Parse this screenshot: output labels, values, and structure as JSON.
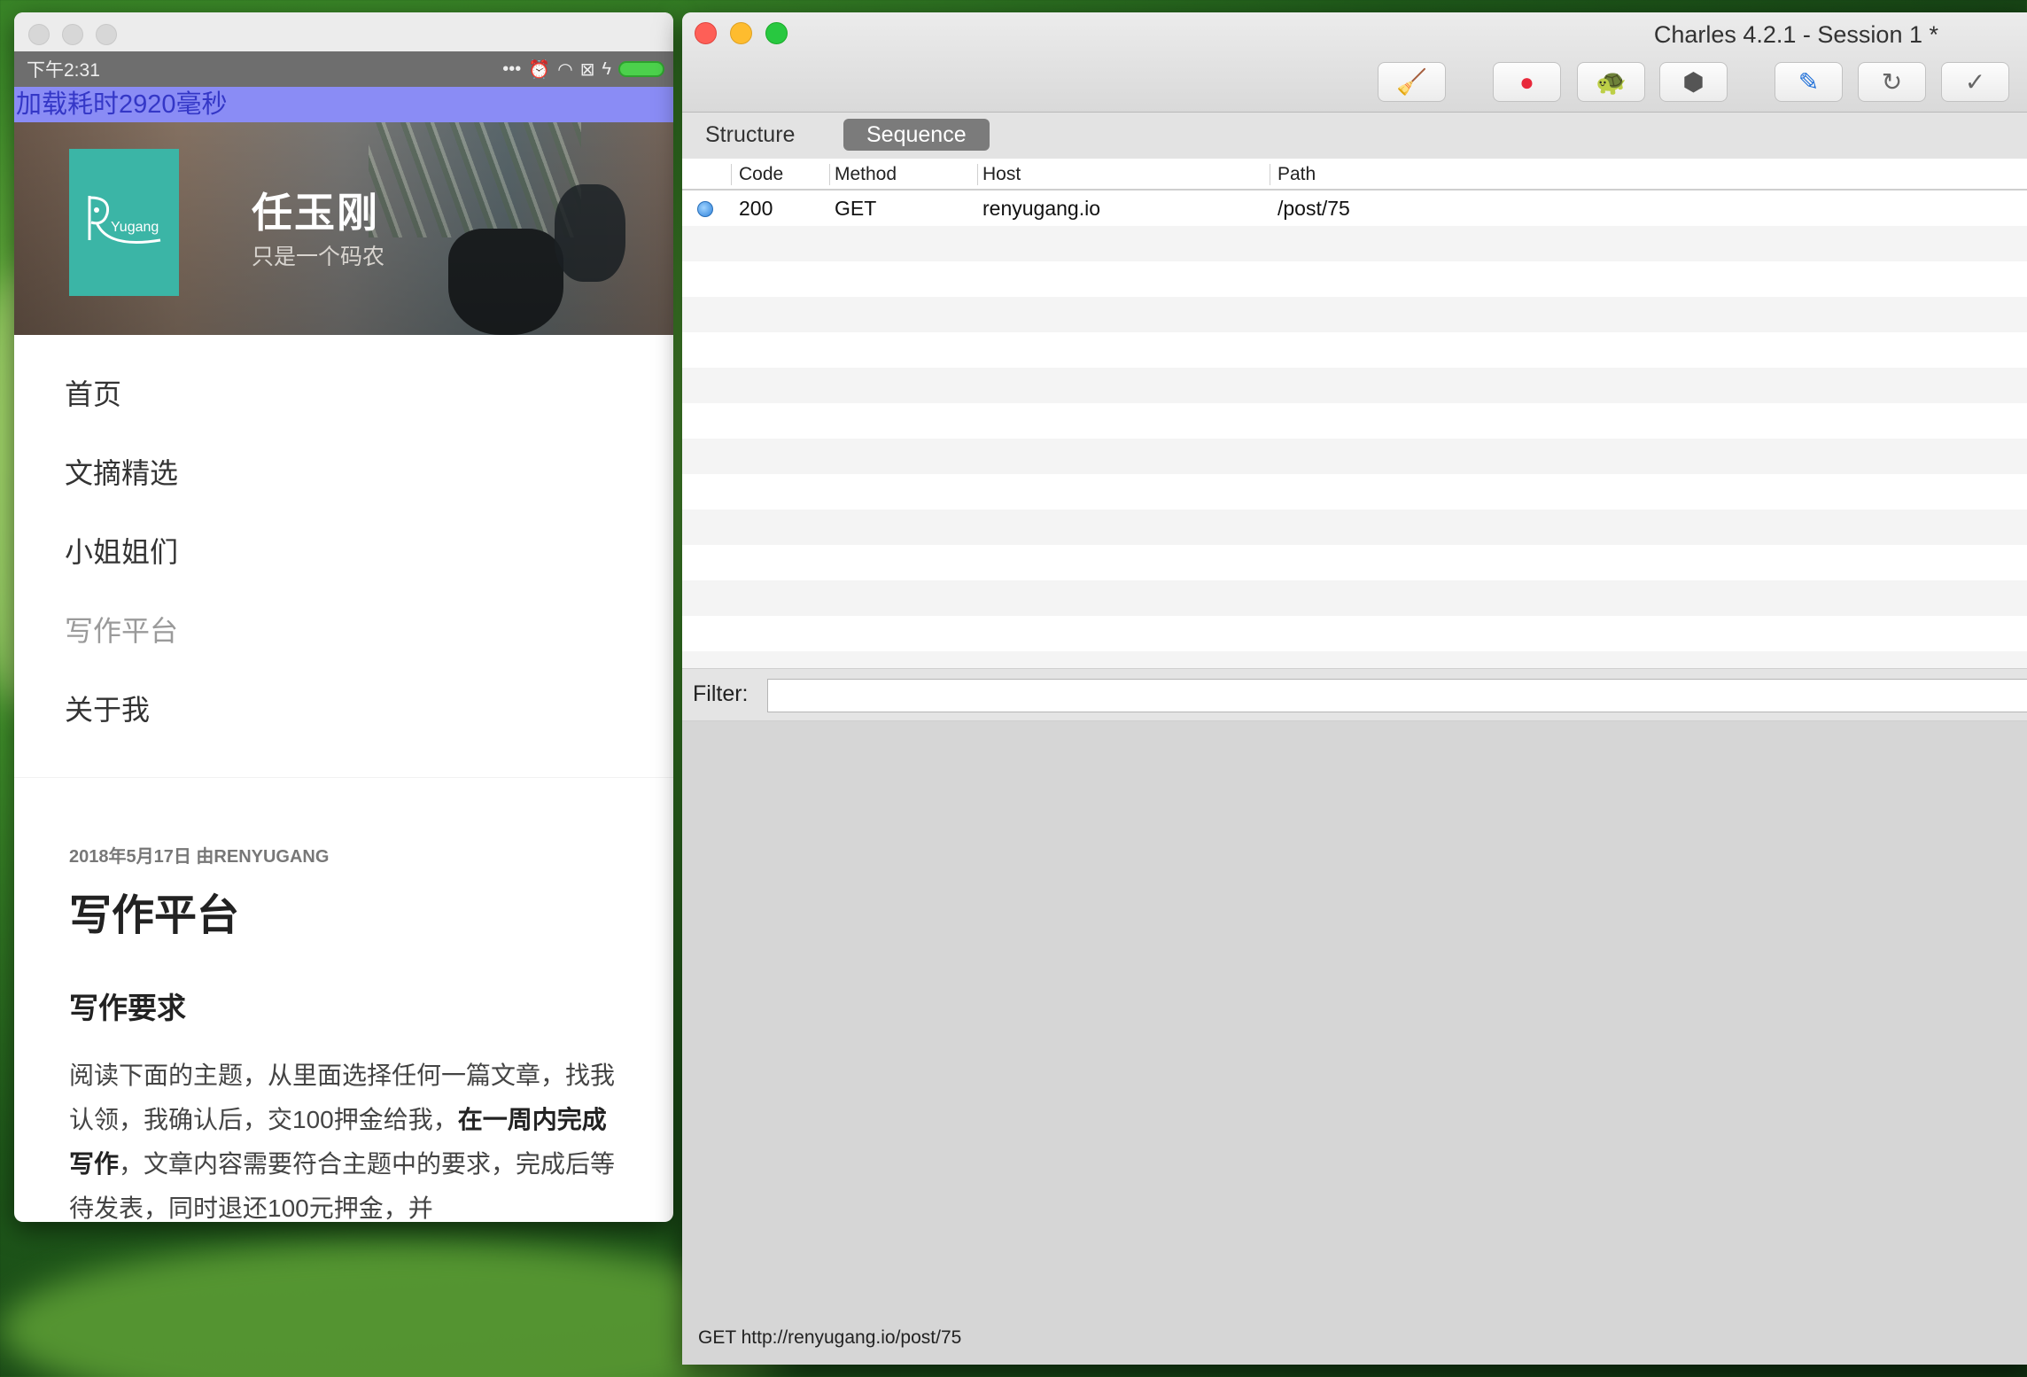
{
  "phone": {
    "status_time": "下午2:31",
    "status_icons": [
      "more-dots-icon",
      "alarm-icon",
      "wifi-icon",
      "sim-icon",
      "charging-icon",
      "battery-icon"
    ],
    "load_banner": "加载耗时2920毫秒",
    "site": {
      "logo_text": "Yugang",
      "name": "任玉刚",
      "tagline": "只是一个码农"
    },
    "nav": [
      {
        "label": "首页"
      },
      {
        "label": "文摘精选"
      },
      {
        "label": "小姐姐们"
      },
      {
        "label": "写作平台",
        "active": true
      },
      {
        "label": "关于我"
      }
    ],
    "article": {
      "meta": "2018年5月17日 由RENYUGANG",
      "title": "写作平台",
      "subtitle": "写作要求",
      "body_1": "阅读下面的主题，从里面选择任何一篇文章，找我认领，我确认后，交100押金给我，",
      "body_bold": "在一周内完成写作",
      "body_2": "，文章内容需要符合主题中的要求，完成后等待发表，同时退还100元押金，并"
    }
  },
  "charles": {
    "title": "Charles 4.2.1 - Session 1 *",
    "toolbar": [
      {
        "name": "broom-icon",
        "glyph": "🧹"
      },
      {
        "name": "record-icon",
        "glyph": "●"
      },
      {
        "name": "throttle-turtle-icon",
        "glyph": "🐢"
      },
      {
        "name": "breakpoint-hexagon-icon",
        "glyph": "⬢"
      },
      {
        "name": "compose-pen-icon",
        "glyph": "✎"
      },
      {
        "name": "repeat-icon",
        "glyph": "↻"
      },
      {
        "name": "validate-check-icon",
        "glyph": "✓"
      }
    ],
    "tabs": {
      "structure": "Structure",
      "sequence": "Sequence"
    },
    "columns": {
      "code": "Code",
      "method": "Method",
      "host": "Host",
      "path": "Path"
    },
    "rows": [
      {
        "code": "200",
        "method": "GET",
        "host": "renyugang.io",
        "path": "/post/75"
      }
    ],
    "filter": {
      "label": "Filter:",
      "value": ""
    },
    "status": "GET http://renyugang.io/post/75",
    "colors": {
      "record_red": "#e8293b",
      "accent": "#7b7b7b"
    }
  }
}
